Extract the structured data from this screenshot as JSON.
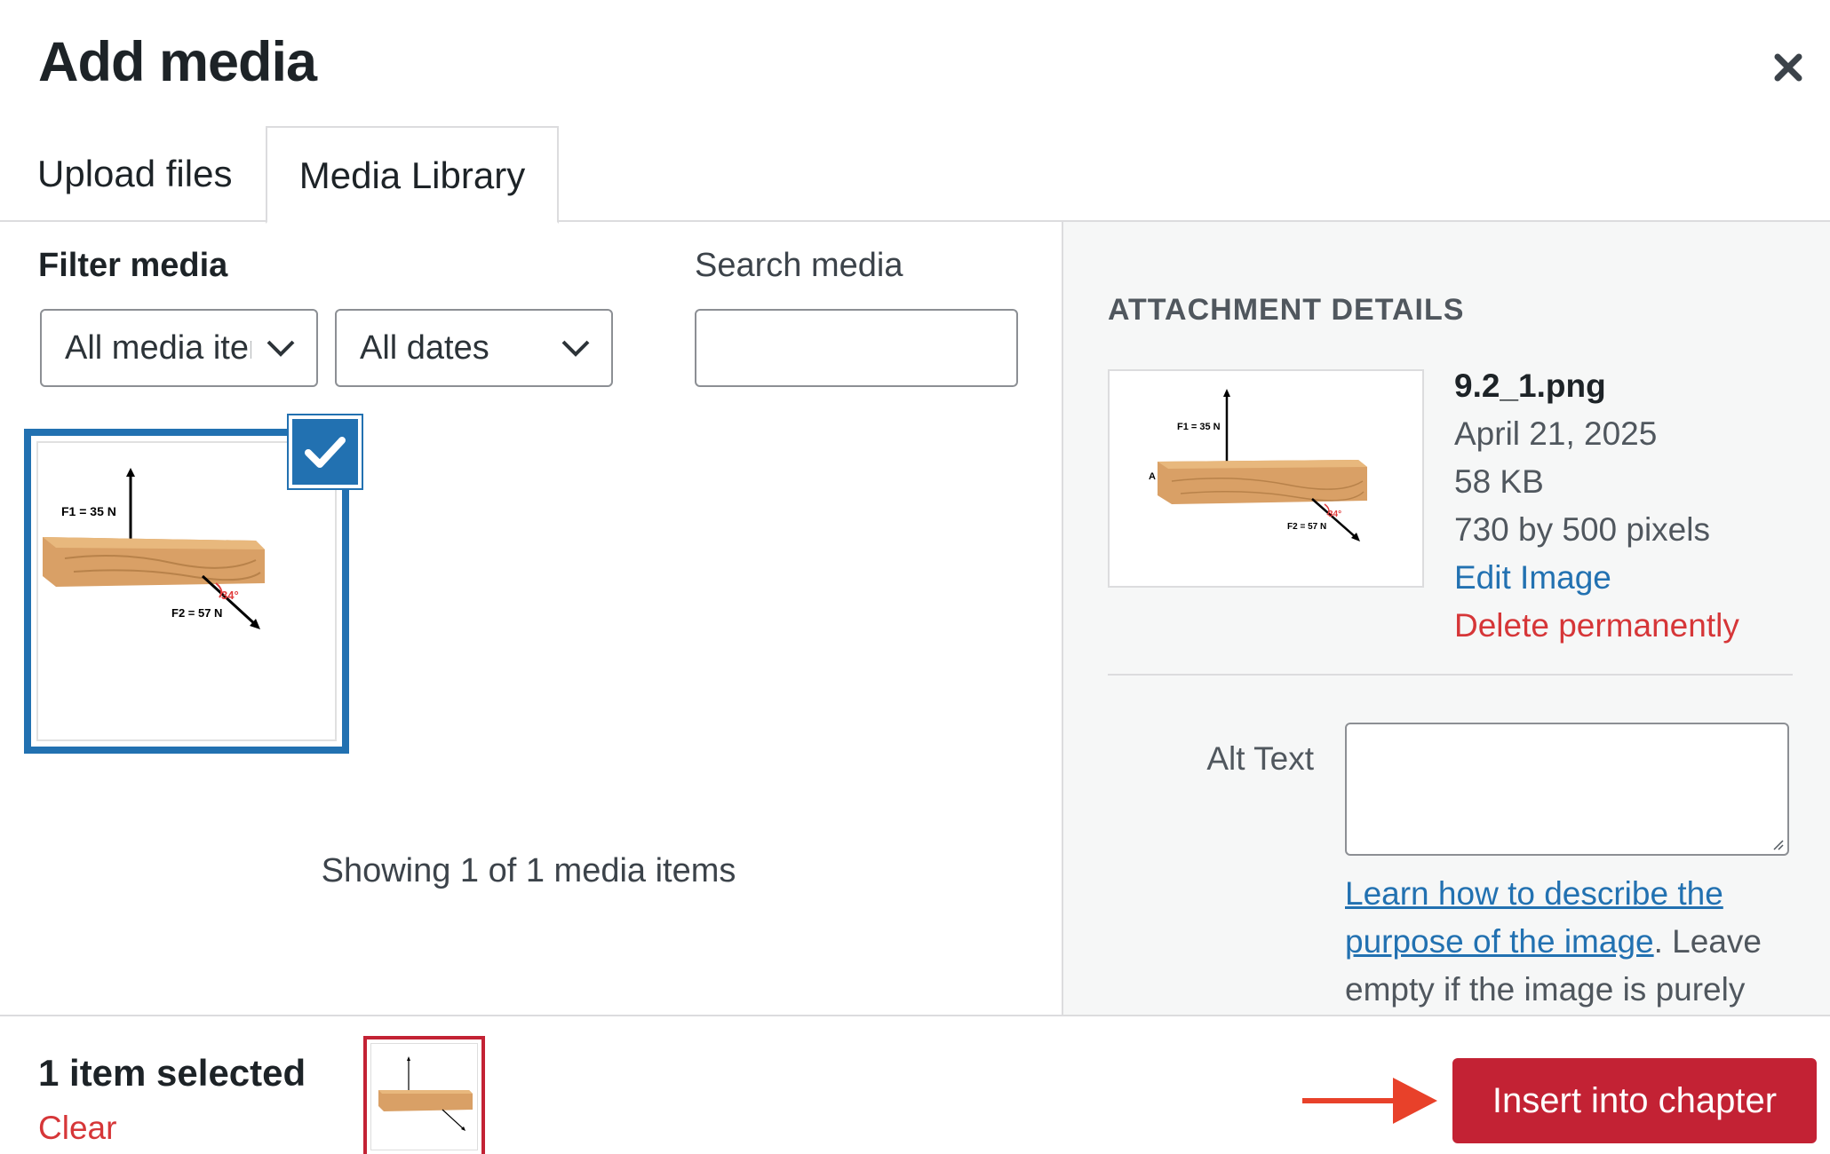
{
  "modal": {
    "title": "Add media",
    "close_icon": "close-icon"
  },
  "tabs": [
    {
      "label": "Upload files",
      "active": false
    },
    {
      "label": "Media Library",
      "active": true
    }
  ],
  "filters": {
    "filter_label": "Filter media",
    "media_type_selected": "All media items",
    "date_selected": "All dates",
    "search_label": "Search media",
    "search_value": ""
  },
  "grid": {
    "items": [
      {
        "filename": "9.2_1.png",
        "selected": true
      }
    ],
    "showing_text": "Showing 1 of 1 media items"
  },
  "diagram": {
    "f1_label": "F1 = 35 N",
    "f2_label": "F2 = 57 N",
    "angle_label": "34°",
    "point_label": "A"
  },
  "attachment_details": {
    "heading": "ATTACHMENT DETAILS",
    "filename": "9.2_1.png",
    "date": "April 21, 2025",
    "size": "58 KB",
    "dimensions": "730 by 500 pixels",
    "edit_link": "Edit Image",
    "delete_link": "Delete permanently",
    "alt_label": "Alt Text",
    "alt_value": "",
    "alt_help_link": "Learn how to describe the purpose of the image",
    "alt_help_text": ". Leave empty if the image is purely"
  },
  "toolbar": {
    "selection_count": "1 item selected",
    "clear_label": "Clear",
    "insert_label": "Insert into chapter"
  },
  "colors": {
    "accent_blue": "#2271b1",
    "danger_red": "#d63638",
    "primary_button": "#c32234",
    "arrow": "#e8412a",
    "wood": "#d9a066"
  }
}
